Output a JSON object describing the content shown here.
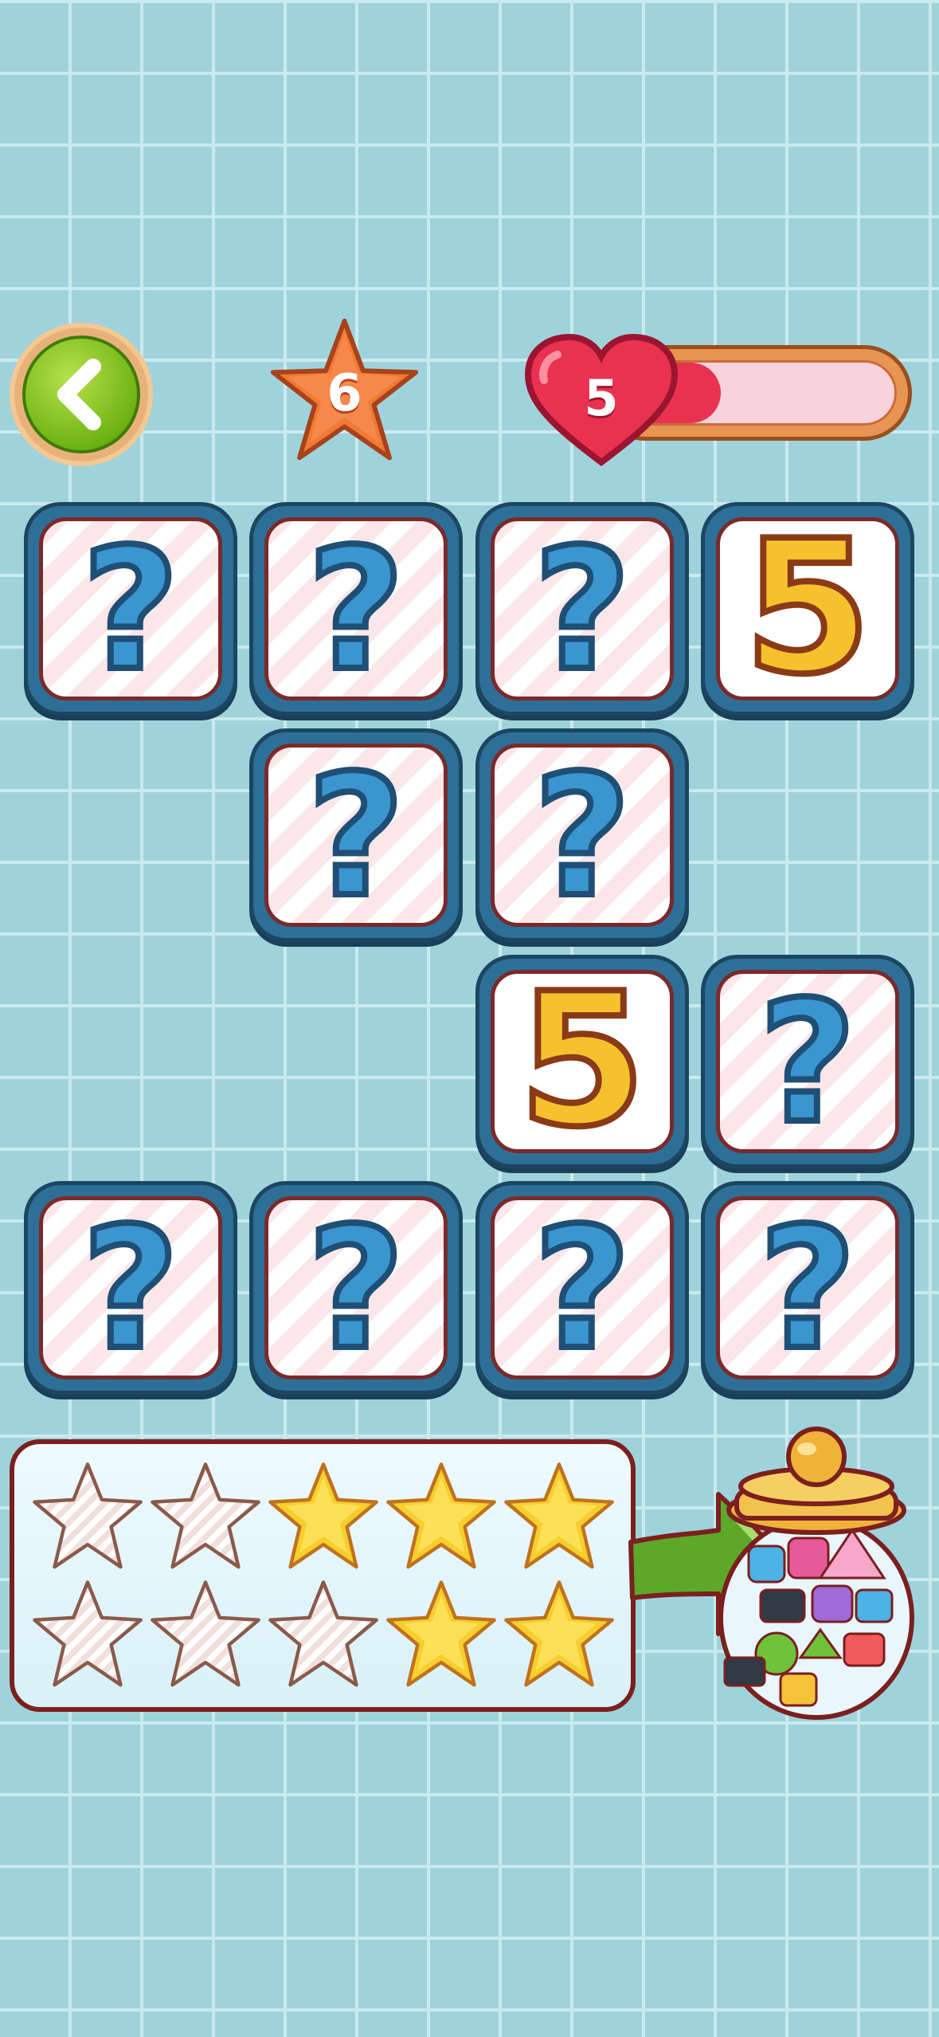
{
  "header": {
    "back_icon": "chevron-left-icon",
    "level_star_value": "6",
    "lives_value": "5",
    "lives_fill_fraction": 0.38,
    "colors": {
      "heart": "#e8324f",
      "star": "#f07a35",
      "back": "#6fb313"
    }
  },
  "board": {
    "rows": [
      [
        "?",
        "?",
        "?",
        "5"
      ],
      [
        "",
        "?",
        "?",
        ""
      ],
      [
        "",
        "",
        "5",
        "?"
      ],
      [
        "?",
        "?",
        "?",
        "?"
      ]
    ]
  },
  "progress": {
    "stars_filled": [
      false,
      false,
      true,
      true,
      true,
      false,
      false,
      false,
      true,
      true
    ]
  },
  "jar": {
    "icon": "candy-jar-icon"
  }
}
